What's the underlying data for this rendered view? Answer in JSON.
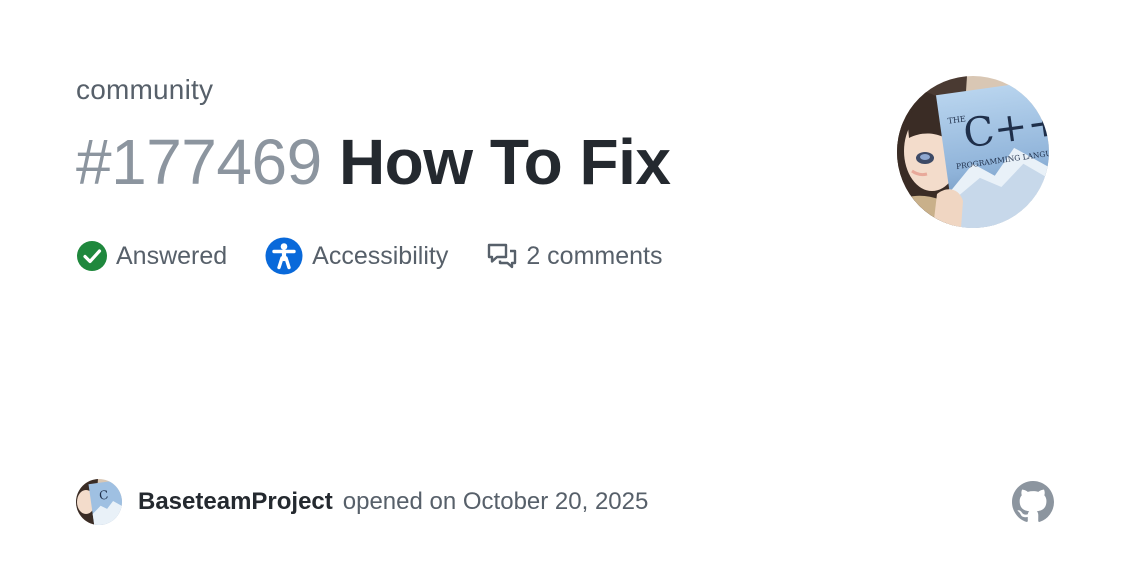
{
  "repo": {
    "name": "community"
  },
  "issue": {
    "number": "#177469",
    "title": "How To Fix"
  },
  "meta": {
    "status": {
      "label": "Answered",
      "icon": "check-circle-icon",
      "color": "#1f883d"
    },
    "category": {
      "label": "Accessibility",
      "icon": "accessibility-icon",
      "color": "#0969da"
    },
    "comments": {
      "label": "2 comments",
      "icon": "comment-discussion-icon"
    }
  },
  "avatar": {
    "book_title_prefix": "THE",
    "book_title": "C++",
    "book_subtitle": "PROGRAMMING LANGUAGE"
  },
  "footer": {
    "author": "BaseteamProject",
    "opened_text": "opened on October 20, 2025",
    "logo_icon": "github-mark-icon"
  },
  "colors": {
    "text_primary": "#24292f",
    "text_secondary": "#57606a",
    "text_muted": "#8c959f"
  }
}
